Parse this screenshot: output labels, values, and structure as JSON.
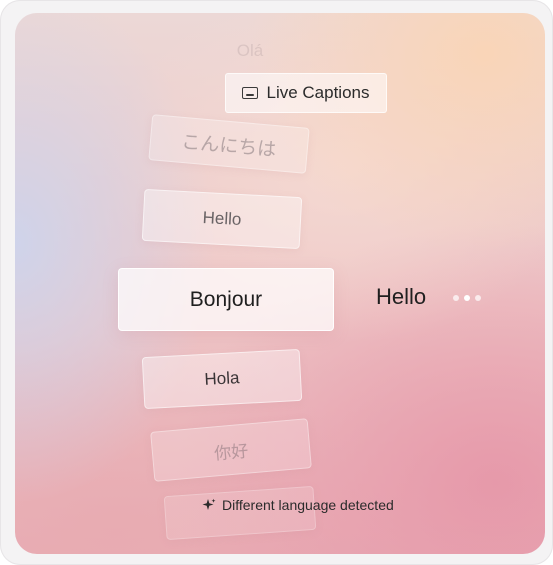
{
  "header": {
    "faded_word": "Olá",
    "pill_label": "Live Captions",
    "pill_icon": "closed-captions-icon"
  },
  "languages": [
    {
      "label": "こんにちは"
    },
    {
      "label": "Hello"
    },
    {
      "label": "Bonjour"
    },
    {
      "label": "Hola"
    },
    {
      "label": "你好"
    }
  ],
  "translation": {
    "text": "Hello",
    "indicator": "typing-dots"
  },
  "footer": {
    "icon": "sparkle-icon",
    "text": "Different language detected"
  },
  "colors": {
    "accent_peach": "#fad5b6",
    "accent_blue": "#cdd4ec",
    "accent_pink": "#e696a8"
  }
}
